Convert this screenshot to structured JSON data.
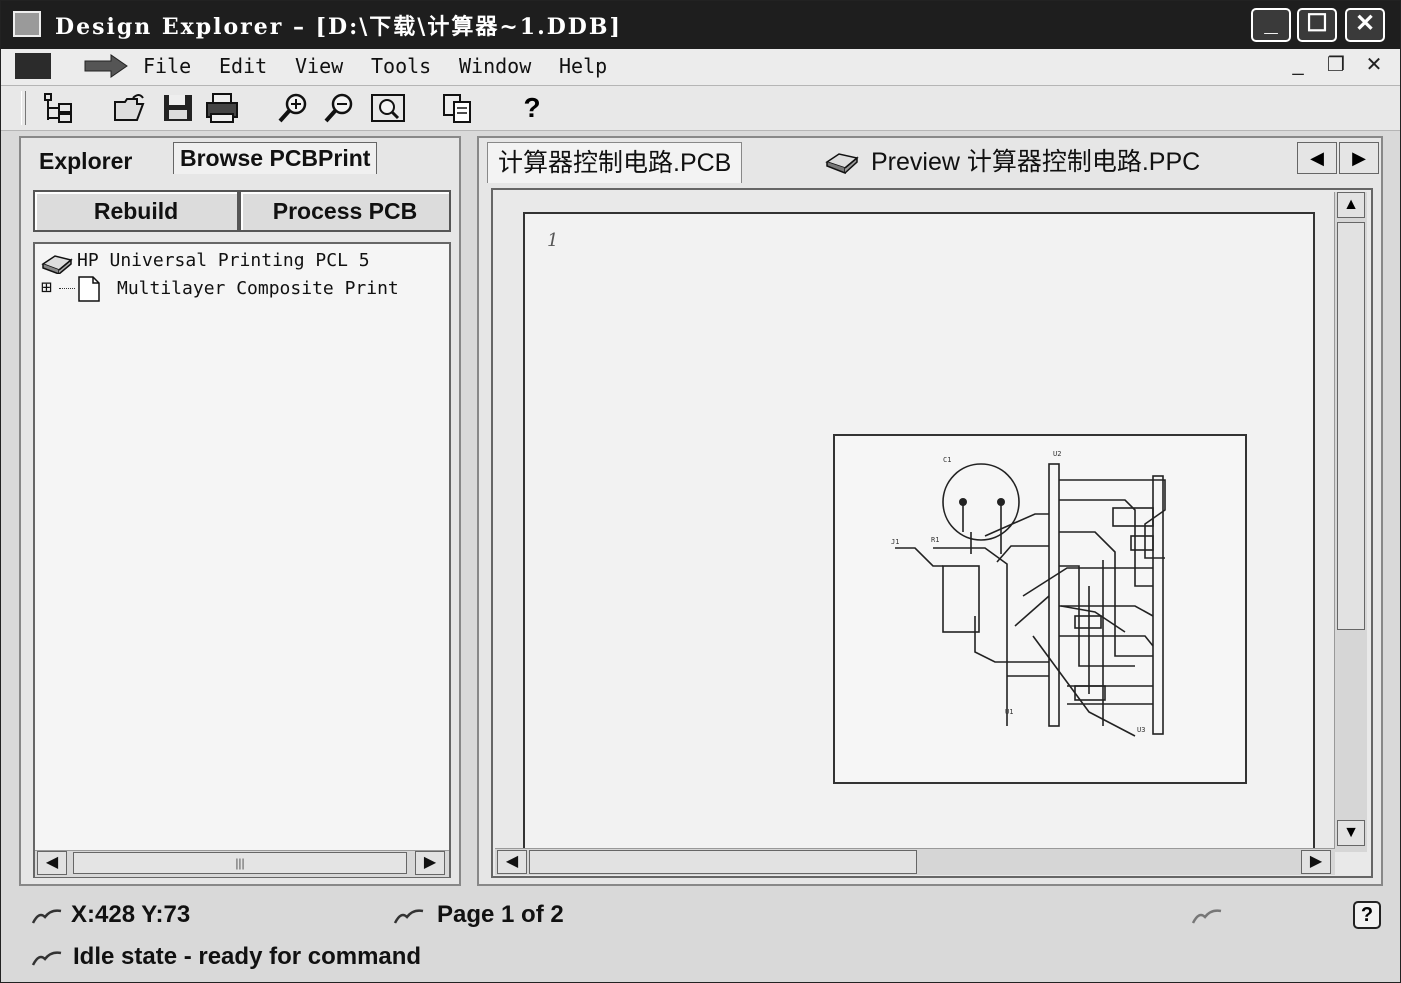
{
  "window": {
    "title": "Design Explorer – [D:\\下载\\计算器~1.DDB]",
    "minimize": "_",
    "maximize": "☐",
    "close": "✕"
  },
  "menu": {
    "items": [
      "File",
      "Edit",
      "View",
      "Tools",
      "Window",
      "Help"
    ],
    "mdi_minimize": "_",
    "mdi_restore": "❐",
    "mdi_close": "✕"
  },
  "toolbar": {
    "icons": [
      "tree-icon",
      "open-folder-icon",
      "save-icon",
      "print-icon",
      "zoom-in-icon",
      "zoom-out-icon",
      "zoom-fit-icon",
      "copy-icon",
      "help-icon"
    ],
    "help_label": "?"
  },
  "left_panel": {
    "tabs": [
      "Explorer",
      "Browse PCBPrint"
    ],
    "buttons": [
      "Rebuild",
      "Process PCB"
    ],
    "tree": [
      {
        "label": "HP Universal Printing PCL 5",
        "icon": "printer-icon",
        "expander": ""
      },
      {
        "label": "Multilayer Composite Print",
        "icon": "document-icon",
        "expander": "⊞"
      }
    ],
    "scroll_left": "◀",
    "scroll_right": "▶",
    "scroll_grip": "|||"
  },
  "right_panel": {
    "tabs": [
      {
        "label": "计算器控制电路.PCB",
        "icon": ""
      },
      {
        "label": "Preview 计算器控制电路.PPC",
        "icon": "printer-icon"
      }
    ],
    "tab_scroll_left": "◀",
    "tab_scroll_right": "▶",
    "page_number": "1",
    "scroll_up": "▲",
    "scroll_down": "▼",
    "scroll_left": "◀",
    "scroll_right": "▶"
  },
  "status": {
    "coords": "X:428 Y:73",
    "page": "Page 1 of 2",
    "state": "Idle state - ready for command",
    "help": "?"
  }
}
